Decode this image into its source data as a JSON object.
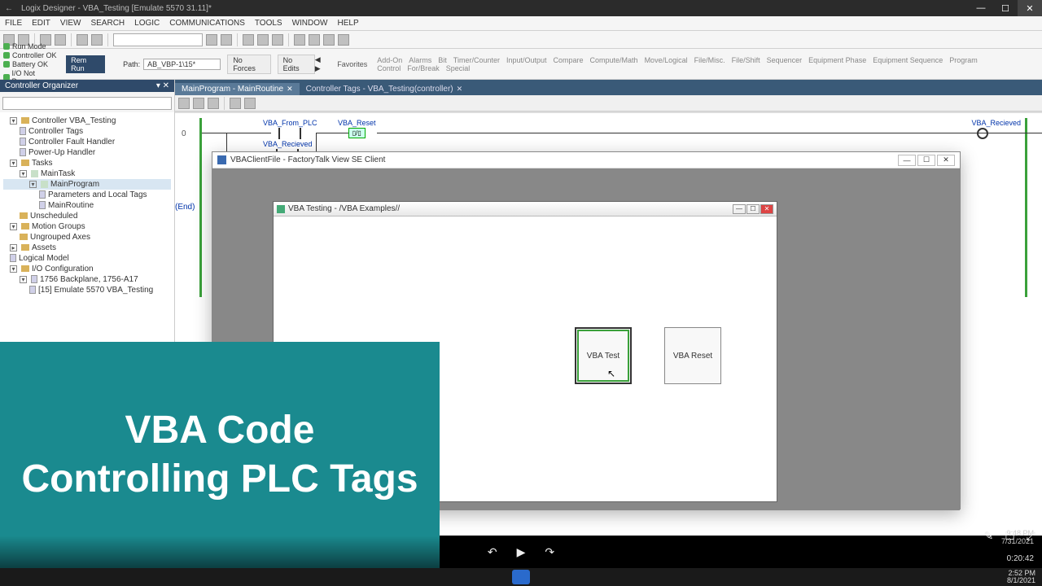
{
  "titlebar": {
    "title": "Logix Designer - VBA_Testing [Emulate 5570 31.11]*"
  },
  "titlebar_controls": {
    "min": "—",
    "max": "☐",
    "close": "✕",
    "back": "←"
  },
  "menubar": [
    "FILE",
    "EDIT",
    "VIEW",
    "SEARCH",
    "LOGIC",
    "COMMUNICATIONS",
    "TOOLS",
    "WINDOW",
    "HELP"
  ],
  "statusbar": {
    "lights": [
      "Run Mode",
      "Controller OK",
      "Battery OK",
      "I/O Not Present"
    ],
    "remrun": "Rem Run",
    "path_label": "Path:",
    "path_value": "AB_VBP-1\\15*",
    "noforces": "No Forces",
    "noedits": "No Edits"
  },
  "favbar": {
    "label": "Favorites",
    "items": [
      "Add-On",
      "Alarms",
      "Bit",
      "Timer/Counter",
      "Input/Output",
      "Compare",
      "Compute/Math",
      "Move/Logical",
      "File/Misc.",
      "File/Shift",
      "Sequencer",
      "Equipment Phase",
      "Equipment Sequence",
      "Program Control",
      "For/Break",
      "Special"
    ]
  },
  "organizer": {
    "title": "Controller Organizer",
    "items": [
      {
        "level": 1,
        "exp": "▾",
        "icon": "folder",
        "label": "Controller VBA_Testing"
      },
      {
        "level": 2,
        "icon": "file",
        "label": "Controller Tags"
      },
      {
        "level": 2,
        "icon": "file",
        "label": "Controller Fault Handler"
      },
      {
        "level": 2,
        "icon": "file",
        "label": "Power-Up Handler"
      },
      {
        "level": 1,
        "exp": "▾",
        "icon": "folder",
        "label": "Tasks"
      },
      {
        "level": 2,
        "exp": "▾",
        "icon": "task",
        "label": "MainTask"
      },
      {
        "level": 3,
        "exp": "▾",
        "icon": "task",
        "label": "MainProgram",
        "selected": true
      },
      {
        "level": 4,
        "icon": "file",
        "label": "Parameters and Local Tags"
      },
      {
        "level": 4,
        "icon": "file",
        "label": "MainRoutine"
      },
      {
        "level": 2,
        "icon": "folder",
        "label": "Unscheduled"
      },
      {
        "level": 1,
        "exp": "▾",
        "icon": "folder",
        "label": "Motion Groups"
      },
      {
        "level": 2,
        "icon": "folder",
        "label": "Ungrouped Axes"
      },
      {
        "level": 1,
        "exp": "▸",
        "icon": "folder",
        "label": "Assets"
      },
      {
        "level": 1,
        "icon": "file",
        "label": "Logical Model"
      },
      {
        "level": 1,
        "exp": "▾",
        "icon": "folder",
        "label": "I/O Configuration"
      },
      {
        "level": 2,
        "exp": "▾",
        "icon": "file",
        "label": "1756 Backplane, 1756-A17"
      },
      {
        "level": 3,
        "icon": "file",
        "label": "[15] Emulate 5570 VBA_Testing"
      }
    ]
  },
  "tabs": [
    {
      "label": "MainProgram - MainRoutine",
      "active": true
    },
    {
      "label": "Controller Tags - VBA_Testing(controller)",
      "active": false
    }
  ],
  "ladder": {
    "rung_num": "0",
    "end": "(End)",
    "instr1": "VBA_From_PLC",
    "instr2": "VBA_Reset",
    "instr3": "VBA_Recieved",
    "out": "VBA_Recieved"
  },
  "ftwin": {
    "title": "VBAClientFile - FactoryTalk View SE Client",
    "inner_title": "VBA Testing - /VBA Examples//",
    "btn_test": "VBA Test",
    "btn_reset": "VBA Reset",
    "controls": {
      "min": "—",
      "max": "☐",
      "close": "✕"
    }
  },
  "overlay": {
    "text": "VBA Code Controlling PLC Tags"
  },
  "player": {
    "back": "↶",
    "play": "▶",
    "fwd": "↷",
    "time": "0:20:42",
    "time2": "9:48 PM",
    "date2": "7/31/2021"
  },
  "taskbar": {
    "time": "2:52 PM",
    "date": "8/1/2021"
  }
}
